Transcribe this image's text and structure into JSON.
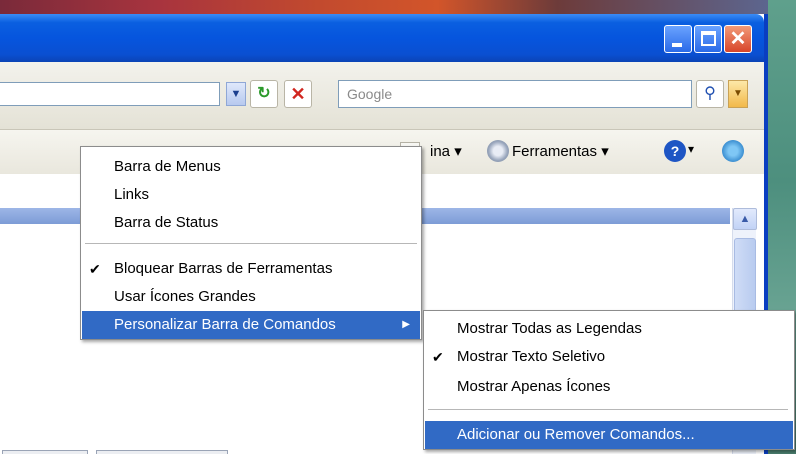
{
  "search": {
    "placeholder": "Google"
  },
  "command_bar": {
    "page_label_fragment": "ina",
    "tools_label": "Ferramentas",
    "dropdown_glyph": "▾"
  },
  "main_menu": {
    "items": [
      {
        "label": "Barra de Menus",
        "checked": false
      },
      {
        "label": "Links",
        "checked": false
      },
      {
        "label": "Barra de Status",
        "checked": false
      },
      {
        "label": "Bloquear Barras de Ferramentas",
        "checked": true
      },
      {
        "label": "Usar Ícones Grandes",
        "checked": false
      },
      {
        "label": "Personalizar Barra de Comandos",
        "checked": false,
        "has_submenu": true,
        "highlighted": true
      }
    ],
    "check_glyph": "✔",
    "submenu_arrow": "▶"
  },
  "sub_menu": {
    "items": [
      {
        "label": "Mostrar Todas as Legendas",
        "checked": false
      },
      {
        "label": "Mostrar Texto Seletivo",
        "checked": true
      },
      {
        "label": "Mostrar Apenas Ícones",
        "checked": false
      },
      {
        "label": "Adicionar ou Remover Comandos...",
        "checked": false,
        "highlighted": true
      }
    ],
    "check_glyph": "✔"
  },
  "window_controls": {
    "close_glyph": "✕"
  },
  "icons": {
    "refresh": "refresh-icon",
    "stop": "stop-icon",
    "search": "magnifier-icon",
    "tools": "gear-icon",
    "help": "help-icon",
    "research": "research-icon"
  },
  "colors": {
    "menu_highlight": "#316ac5",
    "titlebar": "#0655de",
    "close_button": "#d8452a"
  }
}
